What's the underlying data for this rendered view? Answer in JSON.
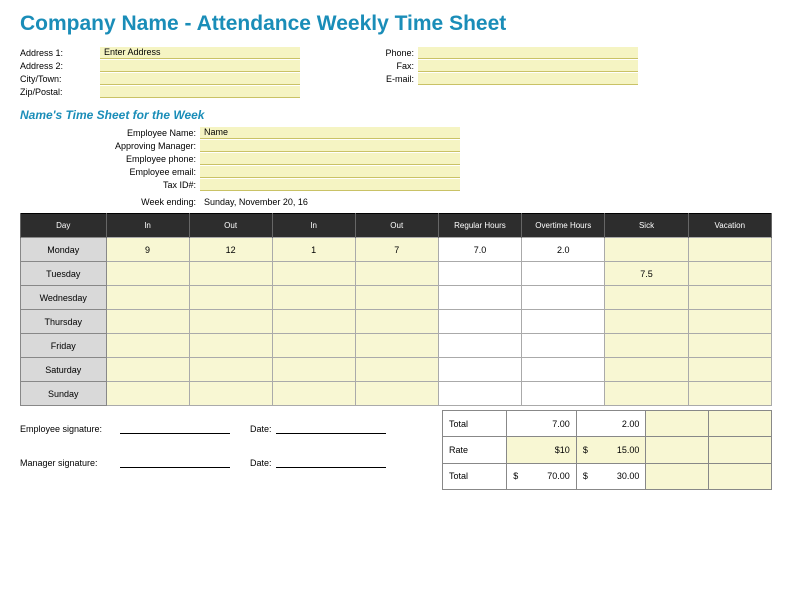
{
  "title": "Company Name - Attendance Weekly Time Sheet",
  "company": {
    "lbl_addr1": "Address 1:",
    "lbl_addr2": "Address 2:",
    "lbl_city": "City/Town:",
    "lbl_zip": "Zip/Postal:",
    "lbl_phone": "Phone:",
    "lbl_fax": "Fax:",
    "lbl_email": "E-mail:",
    "val_addr1": "Enter Address",
    "val_addr2": "",
    "val_city": "",
    "val_zip": "",
    "val_phone": "",
    "val_fax": "",
    "val_email": ""
  },
  "subtitle": "Name's Time Sheet for the Week",
  "employee": {
    "lbl_name": "Employee Name:",
    "lbl_mgr": "Approving Manager:",
    "lbl_phone": "Employee phone:",
    "lbl_email": "Employee email:",
    "lbl_tax": "Tax ID#:",
    "val_name": "Name",
    "val_mgr": "",
    "val_phone": "",
    "val_email": "",
    "val_tax": ""
  },
  "week": {
    "lbl": "Week ending:",
    "val": "Sunday, November 20, 16"
  },
  "headers": {
    "day": "Day",
    "in1": "In",
    "out1": "Out",
    "in2": "In",
    "out2": "Out",
    "reg": "Regular Hours",
    "ot": "Overtime Hours",
    "sick": "Sick",
    "vac": "Vacation"
  },
  "rows": [
    {
      "day": "Monday",
      "in1": "9",
      "out1": "12",
      "in2": "1",
      "out2": "7",
      "reg": "7.0",
      "ot": "2.0",
      "sick": "",
      "vac": ""
    },
    {
      "day": "Tuesday",
      "in1": "",
      "out1": "",
      "in2": "",
      "out2": "",
      "reg": "",
      "ot": "",
      "sick": "7.5",
      "vac": ""
    },
    {
      "day": "Wednesday",
      "in1": "",
      "out1": "",
      "in2": "",
      "out2": "",
      "reg": "",
      "ot": "",
      "sick": "",
      "vac": ""
    },
    {
      "day": "Thursday",
      "in1": "",
      "out1": "",
      "in2": "",
      "out2": "",
      "reg": "",
      "ot": "",
      "sick": "",
      "vac": ""
    },
    {
      "day": "Friday",
      "in1": "",
      "out1": "",
      "in2": "",
      "out2": "",
      "reg": "",
      "ot": "",
      "sick": "",
      "vac": ""
    },
    {
      "day": "Saturday",
      "in1": "",
      "out1": "",
      "in2": "",
      "out2": "",
      "reg": "",
      "ot": "",
      "sick": "",
      "vac": ""
    },
    {
      "day": "Sunday",
      "in1": "",
      "out1": "",
      "in2": "",
      "out2": "",
      "reg": "",
      "ot": "",
      "sick": "",
      "vac": ""
    }
  ],
  "summary": {
    "lbl_total1": "Total",
    "reg_total": "7.00",
    "ot_total": "2.00",
    "lbl_rate": "Rate",
    "reg_rate": "$10",
    "ot_rate": "15.00",
    "lbl_total2": "Total",
    "reg_grand": "70.00",
    "ot_grand": "30.00",
    "curr": "$"
  },
  "sig": {
    "emp": "Employee signature:",
    "mgr": "Manager signature:",
    "date": "Date:"
  }
}
